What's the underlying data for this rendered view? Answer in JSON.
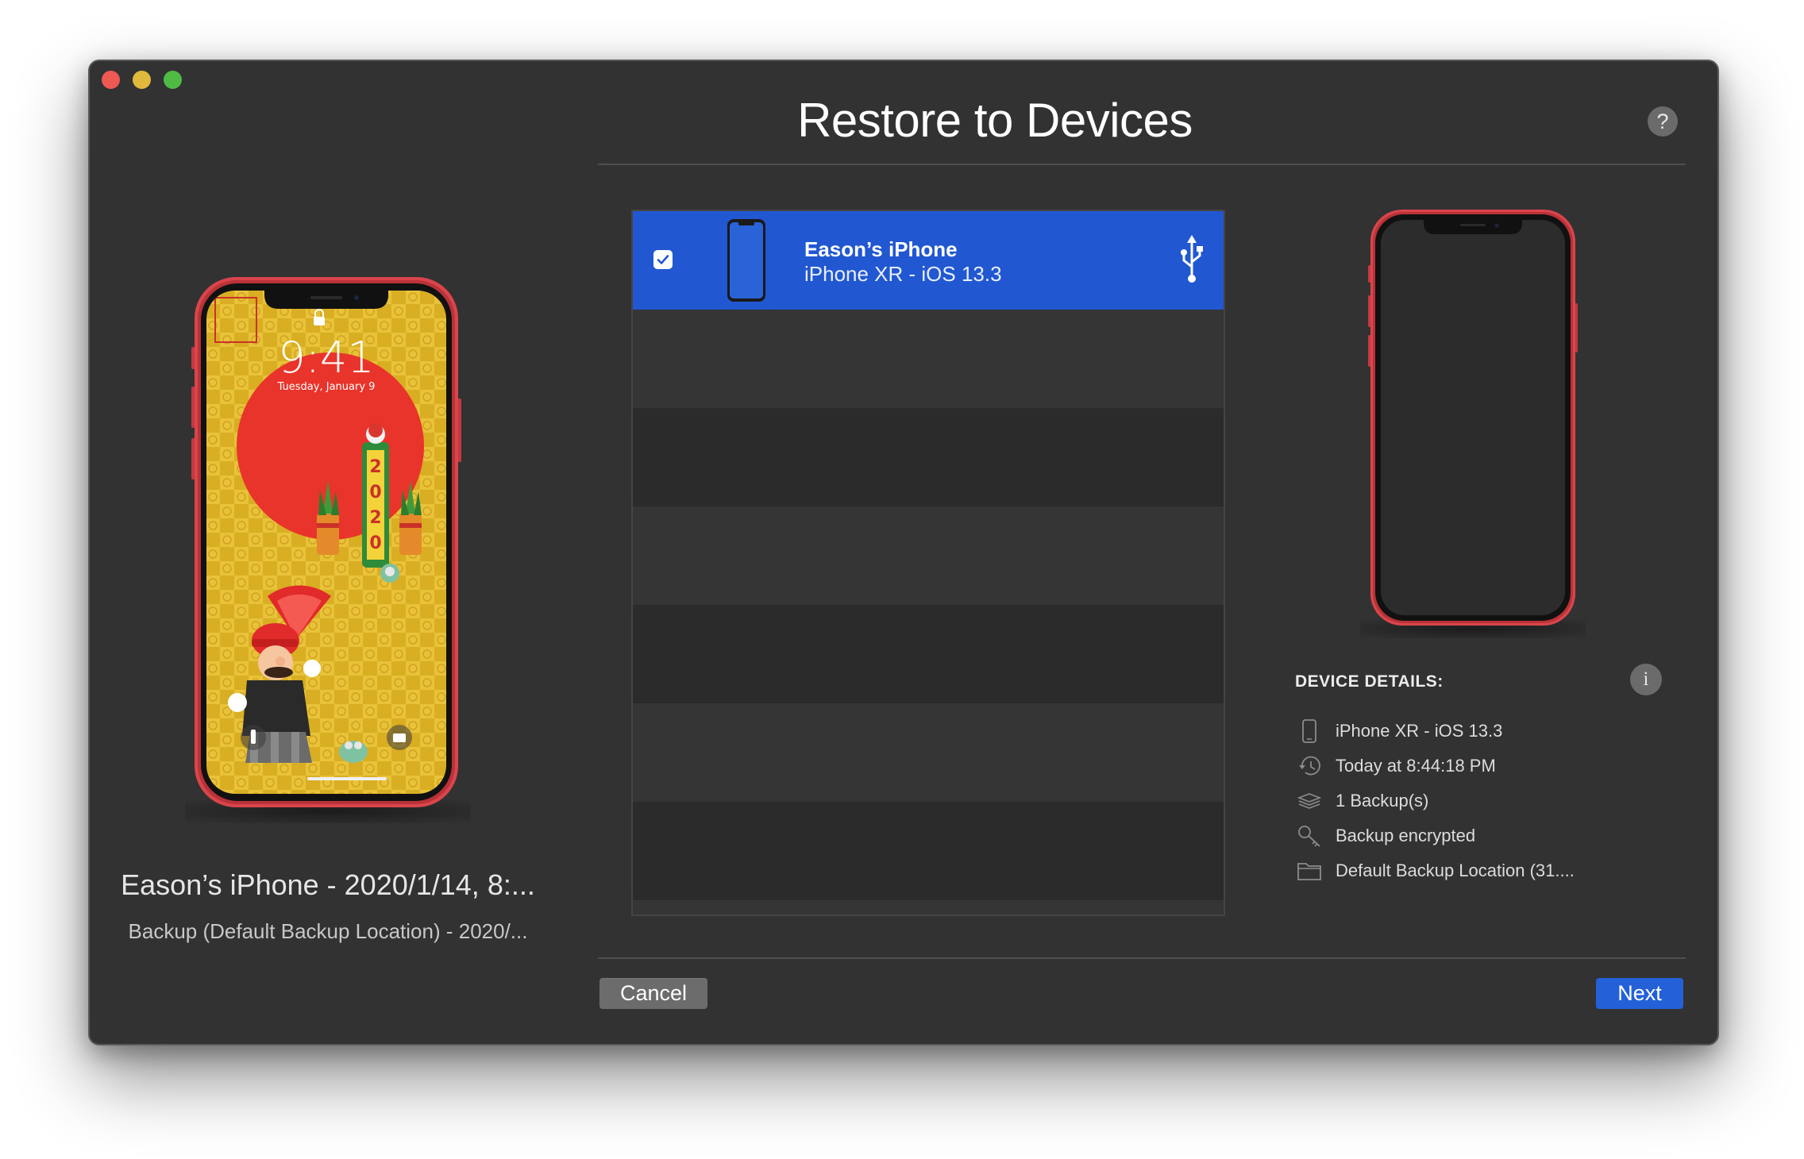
{
  "window": {
    "title": "Restore to Devices",
    "help_label": "?"
  },
  "backup": {
    "title": "Eason’s iPhone - 2020/1/14, 8:...",
    "subtitle": "Backup (Default Backup Location) - 2020/...",
    "lock_time": "9:41",
    "lock_date": "Tuesday, January 9"
  },
  "device_list": {
    "devices": [
      {
        "name": "Eason’s iPhone",
        "detail": "iPhone XR - iOS 13.3",
        "checked": true,
        "connection_icon": "usb-icon"
      }
    ]
  },
  "details": {
    "heading": "DEVICE DETAILS:",
    "info_label": "i",
    "items": [
      {
        "icon": "phone-icon",
        "text": "iPhone XR - iOS 13.3"
      },
      {
        "icon": "history-icon",
        "text": "Today at 8:44:18 PM"
      },
      {
        "icon": "stack-icon",
        "text": "1 Backup(s)"
      },
      {
        "icon": "key-icon",
        "text": "Backup encrypted"
      },
      {
        "icon": "folder-icon",
        "text": "Default Backup Location (31...."
      }
    ]
  },
  "buttons": {
    "cancel": "Cancel",
    "next": "Next"
  },
  "colors": {
    "window_bg": "#323232",
    "selection": "#2257d2",
    "accent_button": "#2461d8",
    "phone_frame": "#d9454b",
    "wallpaper_gold": "#e0b92a",
    "sun_red": "#e8342a"
  }
}
